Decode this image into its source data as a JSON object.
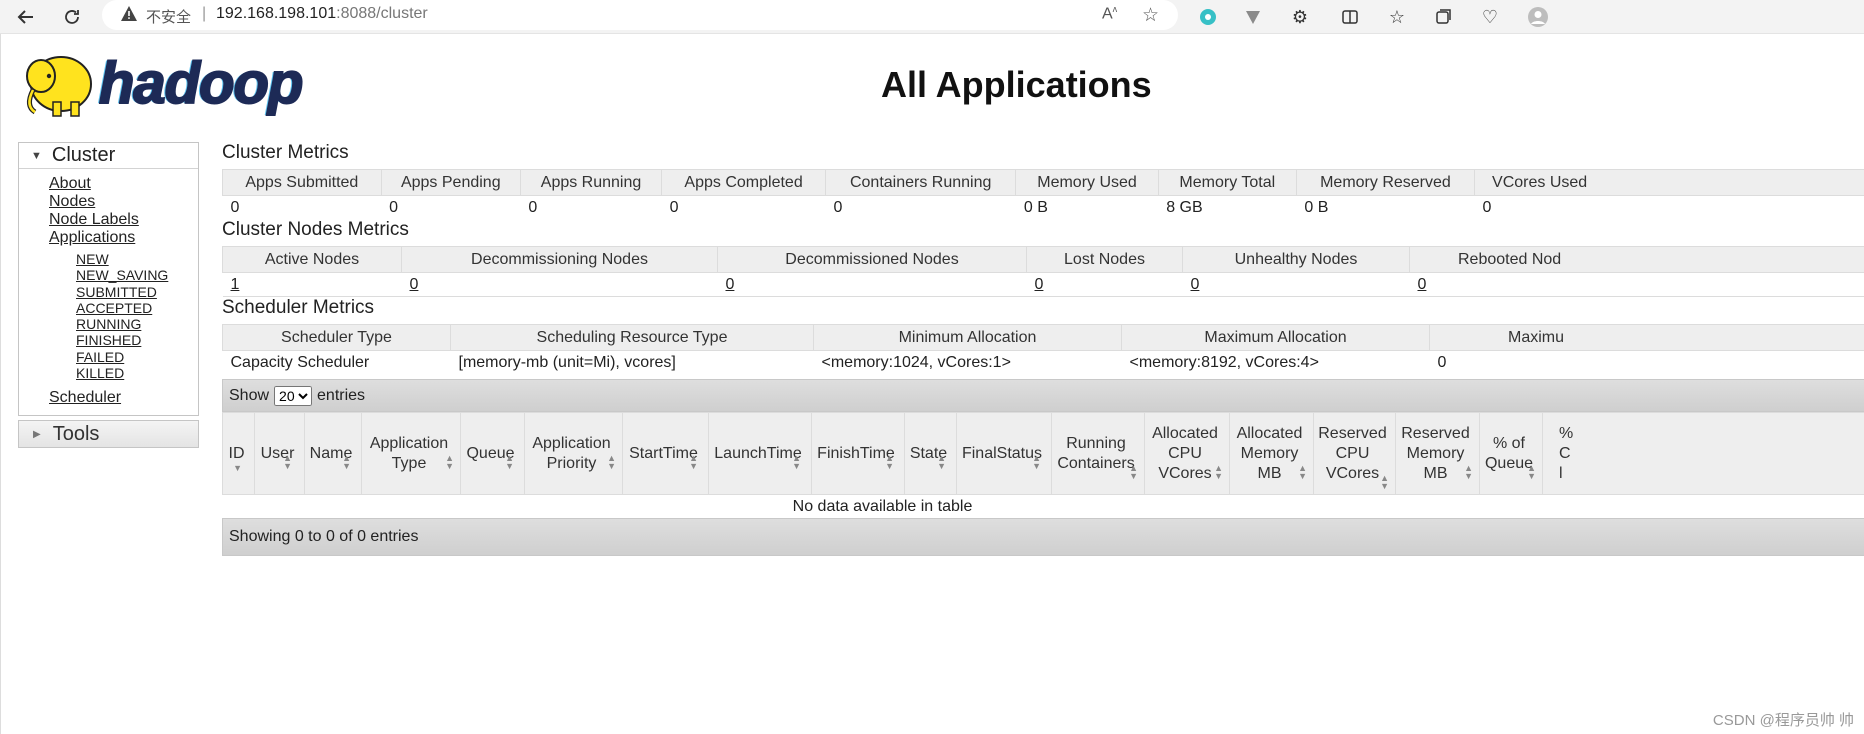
{
  "browser": {
    "insecure_label": "不安全",
    "separator": "|",
    "url_host": "192.168.198.101",
    "url_rest": ":8088/cluster"
  },
  "page": {
    "logo_text": "hadoop",
    "title": "All Applications"
  },
  "sidebar": {
    "cluster_label": "Cluster",
    "links": [
      "About",
      "Nodes",
      "Node Labels",
      "Applications"
    ],
    "app_states": [
      "NEW",
      "NEW_SAVING",
      "SUBMITTED",
      "ACCEPTED",
      "RUNNING",
      "FINISHED",
      "FAILED",
      "KILLED"
    ],
    "scheduler_label": "Scheduler",
    "tools_label": "Tools"
  },
  "cluster_metrics": {
    "title": "Cluster Metrics",
    "headers": [
      "Apps Submitted",
      "Apps Pending",
      "Apps Running",
      "Apps Completed",
      "Containers Running",
      "Memory Used",
      "Memory Total",
      "Memory Reserved",
      "VCores Used"
    ],
    "values": [
      "0",
      "0",
      "0",
      "0",
      "0",
      "0 B",
      "8 GB",
      "0 B",
      "0"
    ]
  },
  "cluster_nodes_metrics": {
    "title": "Cluster Nodes Metrics",
    "headers": [
      "Active Nodes",
      "Decommissioning Nodes",
      "Decommissioned Nodes",
      "Lost Nodes",
      "Unhealthy Nodes",
      "Rebooted Nod"
    ],
    "values": [
      "1",
      "0",
      "0",
      "0",
      "0",
      "0"
    ]
  },
  "scheduler_metrics": {
    "title": "Scheduler Metrics",
    "headers": [
      "Scheduler Type",
      "Scheduling Resource Type",
      "Minimum Allocation",
      "Maximum Allocation",
      "Maximu"
    ],
    "values": [
      "Capacity Scheduler",
      "[memory-mb (unit=Mi), vcores]",
      "<memory:1024, vCores:1>",
      "<memory:8192, vCores:4>",
      "0"
    ]
  },
  "apps_table": {
    "show_label": "Show",
    "entries_value": "20",
    "entries_label": "entries",
    "columns": [
      "ID",
      "User",
      "Name",
      "Application Type",
      "Queue",
      "Application Priority",
      "StartTime",
      "LaunchTime",
      "FinishTime",
      "State",
      "FinalStatus",
      "Running Containers",
      "Allocated CPU VCores",
      "Allocated Memory MB",
      "Reserved CPU VCores",
      "Reserved Memory MB",
      "% of Queue",
      "% Cl"
    ],
    "empty_message": "No data available in table",
    "footer": "Showing 0 to 0 of 0 entries"
  },
  "watermark": "CSDN @程序员帅 帅"
}
